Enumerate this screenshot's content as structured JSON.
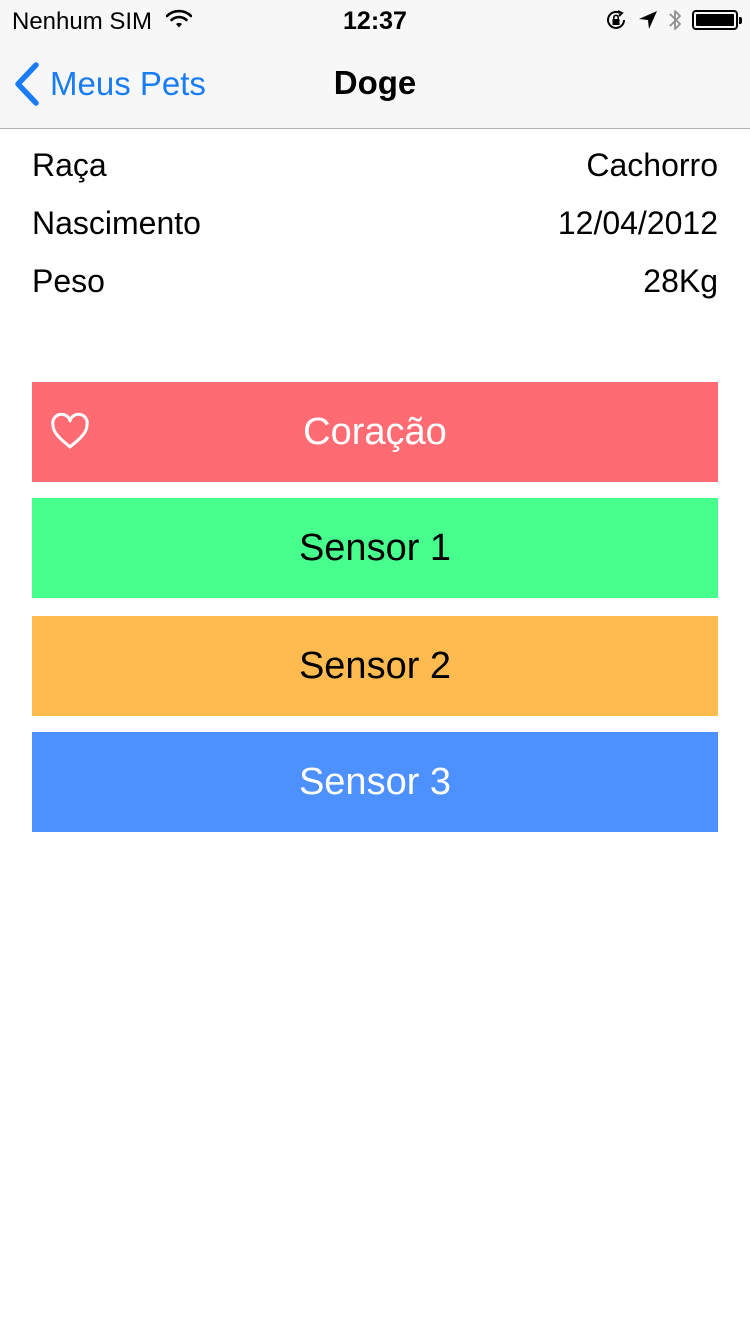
{
  "status_bar": {
    "carrier": "Nenhum SIM",
    "time": "12:37",
    "icons": [
      "wifi-icon",
      "orientation-lock-icon",
      "location-arrow-icon",
      "bluetooth-icon",
      "battery-icon"
    ]
  },
  "nav": {
    "back_label": "Meus Pets",
    "title": "Doge",
    "accent_color": "#1a7cf5"
  },
  "info": {
    "rows": [
      {
        "label": "Raça",
        "value": "Cachorro"
      },
      {
        "label": "Nascimento",
        "value": "12/04/2012"
      },
      {
        "label": "Peso",
        "value": "28Kg"
      }
    ]
  },
  "buttons": {
    "heart": {
      "label": "Coração",
      "color": "#ff6b72",
      "icon": "heart-outline-icon"
    },
    "sensor1": {
      "label": "Sensor 1",
      "color": "#47ff8d"
    },
    "sensor2": {
      "label": "Sensor 2",
      "color": "#ffbb50"
    },
    "sensor3": {
      "label": "Sensor 3",
      "color": "#4d90ff"
    }
  }
}
